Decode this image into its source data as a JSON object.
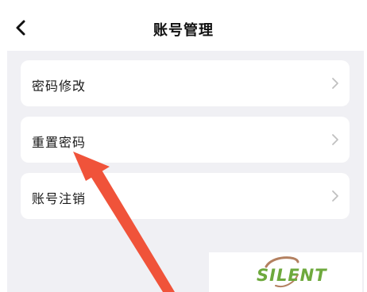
{
  "header": {
    "title": "账号管理",
    "back_icon": "chevron-left-icon"
  },
  "menu": {
    "items": [
      {
        "label": "密码修改",
        "icon": "chevron-right-icon"
      },
      {
        "label": "重置密码",
        "icon": "chevron-right-icon"
      },
      {
        "label": "账号注销",
        "icon": "chevron-right-icon"
      }
    ]
  },
  "watermark": {
    "text": "SILENT",
    "colors": {
      "text": "#6ea93d",
      "swoosh": "#b38060"
    }
  },
  "annotation": {
    "type": "arrow",
    "color": "#f0533a"
  },
  "colors": {
    "background": "#f0f0f4",
    "card": "#ffffff",
    "text": "#1a1a1a",
    "chevron": "#c0c0c0"
  }
}
